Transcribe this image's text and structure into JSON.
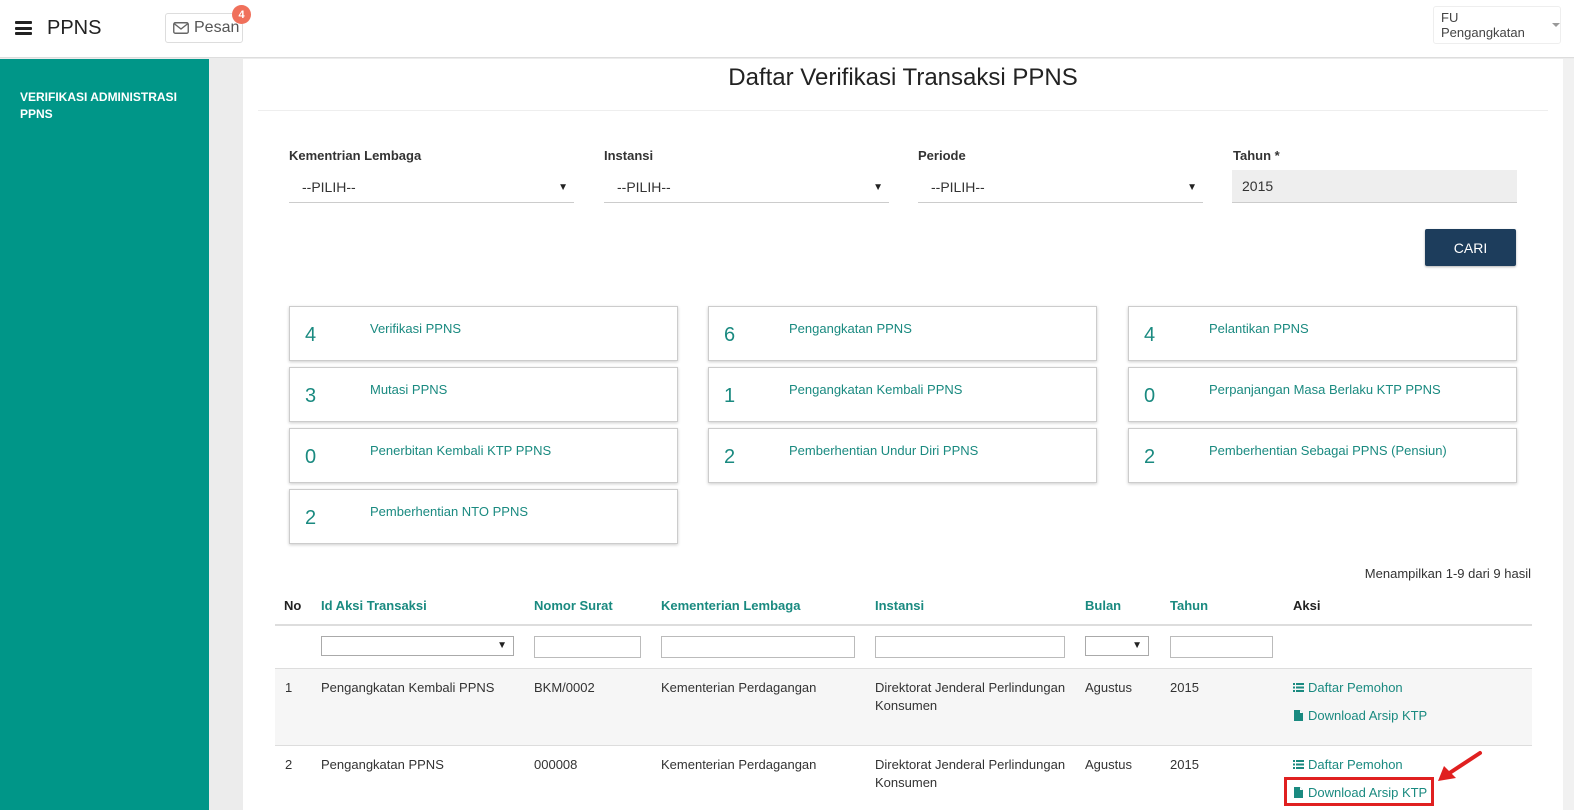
{
  "app": {
    "title": "PPNS"
  },
  "header": {
    "messages_label": "Pesan",
    "messages_count": "4",
    "user_role": "FU Pengangkatan"
  },
  "sidebar": {
    "items": [
      {
        "label": "VERIFIKASI ADMINISTRASI PPNS"
      }
    ]
  },
  "page": {
    "title": "Daftar Verifikasi Transaksi PPNS"
  },
  "filters": {
    "kementrian": {
      "label": "Kementrian Lembaga",
      "value": "--PILIH--"
    },
    "instansi": {
      "label": "Instansi",
      "value": "--PILIH--"
    },
    "periode": {
      "label": "Periode",
      "value": "--PILIH--"
    },
    "tahun": {
      "label": "Tahun *",
      "value": "2015"
    },
    "search_button": "CARI"
  },
  "cards": [
    {
      "count": "4",
      "label": "Verifikasi PPNS"
    },
    {
      "count": "6",
      "label": "Pengangkatan PPNS"
    },
    {
      "count": "4",
      "label": "Pelantikan PPNS"
    },
    {
      "count": "3",
      "label": "Mutasi PPNS"
    },
    {
      "count": "1",
      "label": "Pengangkatan Kembali PPNS"
    },
    {
      "count": "0",
      "label": "Perpanjangan Masa Berlaku KTP PPNS"
    },
    {
      "count": "0",
      "label": "Penerbitan Kembali KTP PPNS"
    },
    {
      "count": "2",
      "label": "Pemberhentian Undur Diri PPNS"
    },
    {
      "count": "2",
      "label": "Pemberhentian Sebagai PPNS (Pensiun)"
    },
    {
      "count": "2",
      "label": "Pemberhentian NTO PPNS"
    }
  ],
  "table": {
    "summary": "Menampilkan 1-9 dari 9 hasil",
    "headers": [
      "No",
      "Id Aksi Transaksi",
      "Nomor Surat",
      "Kementerian Lembaga",
      "Instansi",
      "Bulan",
      "Tahun",
      "Aksi"
    ],
    "rows": [
      {
        "no": "1",
        "aksi_transaksi": "Pengangkatan Kembali PPNS",
        "nomor_surat": "BKM/0002",
        "kementerian": "Kementerian Perdagangan",
        "instansi_line1": "Direktorat Jenderal Perlindungan",
        "instansi_line2": "Konsumen",
        "bulan": "Agustus",
        "tahun": "2015",
        "action1": "Daftar Pemohon",
        "action2": "Download Arsip KTP"
      },
      {
        "no": "2",
        "aksi_transaksi": "Pengangkatan PPNS",
        "nomor_surat": "000008",
        "kementerian": "Kementerian Perdagangan",
        "instansi_line1": "Direktorat Jenderal Perlindungan",
        "instansi_line2": "Konsumen",
        "bulan": "Agustus",
        "tahun": "2015",
        "action1": "Daftar Pemohon",
        "action2": "Download Arsip KTP"
      }
    ]
  },
  "colors": {
    "sidebar": "#009688",
    "accent": "#1a8a80",
    "button": "#1d3d5c",
    "badge": "#f0705b",
    "highlight": "#e02020"
  }
}
